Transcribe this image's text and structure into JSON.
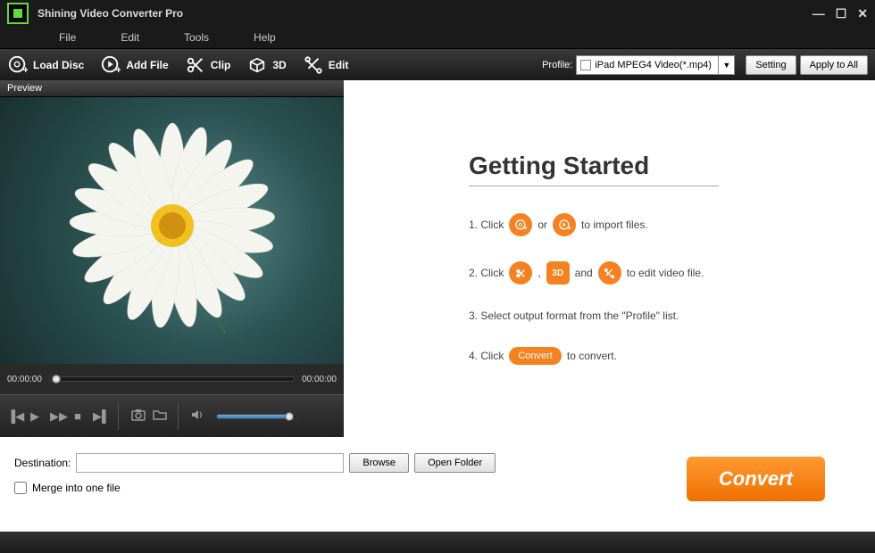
{
  "app": {
    "title": "Shining Video Converter Pro"
  },
  "menu": {
    "file": "File",
    "edit": "Edit",
    "tools": "Tools",
    "help": "Help"
  },
  "toolbar": {
    "load_disc": "Load Disc",
    "add_file": "Add File",
    "clip": "Clip",
    "three_d": "3D",
    "edit": "Edit",
    "profile_label": "Profile:",
    "profile_value": "iPad MPEG4 Video(*.mp4)",
    "setting": "Setting",
    "apply_all": "Apply to All"
  },
  "preview": {
    "title": "Preview",
    "time_start": "00:00:00",
    "time_end": "00:00:00"
  },
  "started": {
    "title": "Getting Started",
    "step1a": "1. Click",
    "step1b": "or",
    "step1c": "to import files.",
    "step2a": "2. Click",
    "step2b": ",",
    "step2c": "and",
    "step2d": "to edit video file.",
    "step3": "3. Select output format from the \"Profile\" list.",
    "step4a": "4. Click",
    "step4b": "Convert",
    "step4c": "to convert.",
    "three_d_label": "3D"
  },
  "bottom": {
    "dest_label": "Destination:",
    "dest_value": "",
    "browse": "Browse",
    "open_folder": "Open Folder",
    "merge": "Merge into one file",
    "convert": "Convert"
  }
}
